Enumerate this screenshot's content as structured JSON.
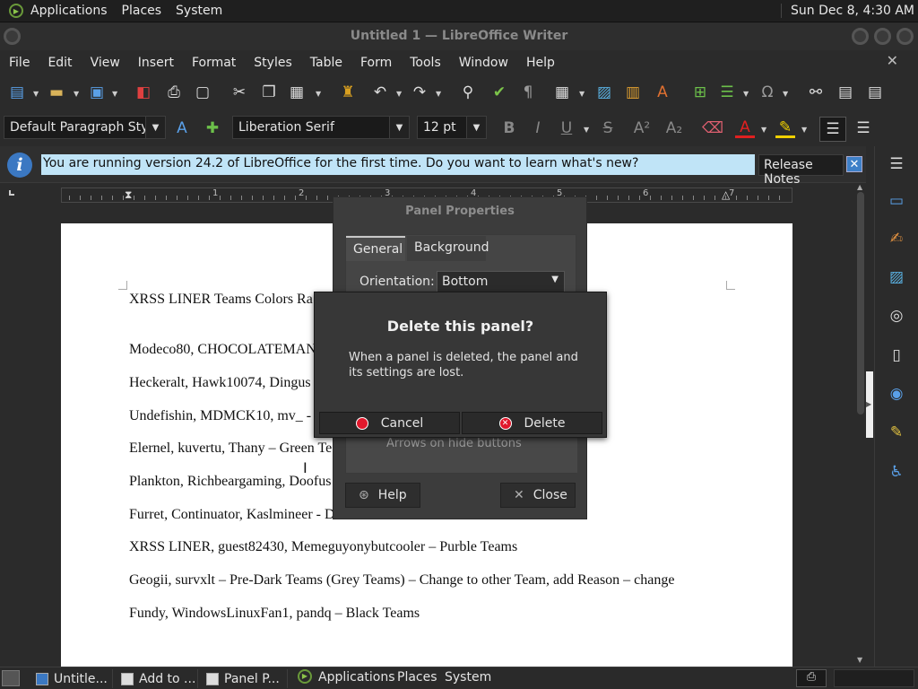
{
  "top_panel": {
    "menus": [
      "Applications",
      "Places",
      "System"
    ],
    "clock": "Sun Dec  8,  4:30 AM"
  },
  "window": {
    "title": "Untitled 1 — LibreOffice Writer"
  },
  "menubar": [
    "File",
    "Edit",
    "View",
    "Insert",
    "Format",
    "Styles",
    "Table",
    "Form",
    "Tools",
    "Window",
    "Help"
  ],
  "formatting": {
    "paragraph_style": "Default Paragraph Style",
    "font_name": "Liberation Serif",
    "font_size": "12 pt"
  },
  "infobar": {
    "message": "You are running version 24.2 of LibreOffice for the first time. Do you want to learn what's new?",
    "release_notes_label": "Release Notes"
  },
  "ruler": {
    "numbers": [
      "1",
      "2",
      "3",
      "4",
      "5",
      "6",
      "7"
    ]
  },
  "document": {
    "lines": [
      "XRSS LINER Teams Colors Ra",
      "Modeco80, CHOCOLATEMAN",
      "Heckeralt, Hawk10074, Dingus",
      "Undefishin, MDMCK10, mv_ -",
      "Elernel, kuvertu, Thany – Green Te",
      "Plankton, Richbeargaming, Doofus",
      "Furret, Continuator, Kaslmineer - Dark Blue Teams",
      "XRSS LINER, guest82430, Memeguyonybutcooler – Purble Teams",
      "Geogii, survxlt – Pre-Dark Teams (Grey Teams) – Change to other Team, add Reason – change",
      "Fundy, WindowsLinuxFan1, pandq – Black Teams"
    ]
  },
  "panel_properties": {
    "title": "Panel Properties",
    "tabs": [
      "General",
      "Background"
    ],
    "orientation_label": "Orientation:",
    "orientation_value": "Bottom",
    "arrows_label": "Arrows on hide buttons",
    "help_label": "Help",
    "close_label": "Close"
  },
  "delete_dialog": {
    "title": "Delete this panel?",
    "message": "When a panel is deleted, the panel and its settings are lost.",
    "cancel_label": "Cancel",
    "delete_label": "Delete"
  },
  "taskbar": {
    "tasks": [
      "Untitle...",
      "Add to ...",
      "Panel P..."
    ],
    "menus": [
      "Applications",
      "Places",
      "System"
    ]
  }
}
